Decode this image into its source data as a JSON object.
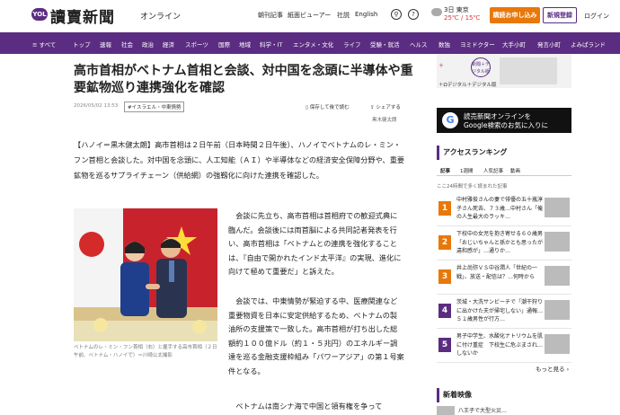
{
  "header": {
    "logo_badge": "YOL",
    "logo": "讀賣新聞",
    "logo_sub": "オンライン",
    "nav": [
      "朝刊記事",
      "紙面ビューアー",
      "社説",
      "English"
    ],
    "weather": {
      "city": "3日 東京",
      "temps": "25℃ / 15℃"
    },
    "subscribe": "購読お申し込み",
    "register": "新規登録",
    "login": "ログイン"
  },
  "nav": [
    "≡ すべて",
    "トップ",
    "速報",
    "社会",
    "政治",
    "経済",
    "スポーツ",
    "国際",
    "地域",
    "科学・IT",
    "エンタメ・文化",
    "ライフ",
    "受験・就活",
    "ヘルス",
    "数独",
    "ヨミドクター",
    "大手小町",
    "発言小町",
    "よみぱランド"
  ],
  "article": {
    "title": "高市首相がベトナム首相と会談、対中国を念頭に半導体や重要鉱物巡り連携強化を確認",
    "date": "2026/05/02 13:53",
    "tag": "#イスラエル・中東情勢",
    "save": "保存して後で読む",
    "share": "シェアする",
    "reporter": "黒木健太朗",
    "lead": "【ハノイ＝黒木健太朗】高市首相は２日午前（日本時間２日午後）、ハノイでベトナムのレ・ミン・フン首相と会談した。対中国を念頭に、人工知能（ＡＩ）や半導体などの経済安全保障分野や、重要鉱物を巡るサプライチェーン（供給網）の強靱化に向けた連携を確認した。",
    "caption": "ベトナムのレ・ミン・フン首相（右）と握手する高市首相（２日午前、ベトナム・ハノイで）＝川崎公太撮影",
    "p1": "会談に先立ち、高市首相は首相府での歓迎式典に臨んだ。会談後には両首脳による共同記者発表を行い、高市首相は「ベトナムとの連携を強化することは、『自由で開かれたインド太平洋』の実現、進化に向けて極めて重要だ」と訴えた。",
    "p2": "会談では、中東情勢が緊迫する中、医療関連など重要物資を日本に安定供給するため、ベトナムの製油所の支援策で一致した。高市首相が打ち出した総額約１００億ドル（約１・５兆円）のエネルギー調達を巡る金融支援枠組み「パワーアジア」の第１号案件となる。",
    "p3": "ベトナムは南シナ海で中国と領有権を争って"
  },
  "sidebar": {
    "ad_text": "＋Ωデジタル＋デジタル版",
    "ad_circle": "新聞＋デジタル版",
    "google_ad": [
      "読売新聞オンラインを",
      "Google検索のお気に入りに"
    ],
    "ranking_title": "アクセスランキング",
    "tabs": [
      "記事",
      "1週間",
      "人気記事",
      "動画"
    ],
    "note": "ここ24時間で多く読まれた記事",
    "items": [
      {
        "rank": "1",
        "text": "中村雅俊さんの妻で俳優の五十嵐淳子さん死去、７３歳…中村さん「俺の人生最大のラッキ…"
      },
      {
        "rank": "2",
        "text": "下校中の女児を抱き寄せる６０歳男「おじいちゃんと孫かとも思ったが違和感が」…通りか…"
      },
      {
        "rank": "3",
        "text": "井上尚弥ＶＳ中谷潤人「世紀の一戦」、放送・配信は？…何時から"
      },
      {
        "rank": "4",
        "text": "茨城・大洗サンビーチで「潮干狩りに出かけた夫が帰宅しない」通報…５１歳男性が行方…"
      },
      {
        "rank": "5",
        "text": "男子中学生、水酸化ナトリウムを肌に付け重症　下校生に危ぶまされ…しないか"
      }
    ],
    "more": "もっと見る",
    "new_title": "新着映像",
    "new_item": "八王子で大型火災…"
  }
}
